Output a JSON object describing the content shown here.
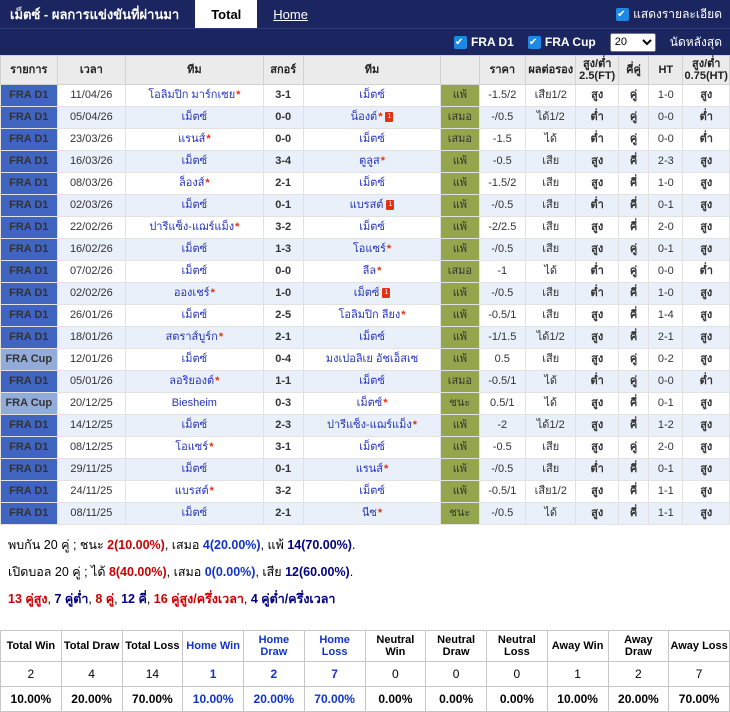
{
  "titlebar": {
    "title": "เม็ตซ์ - ผลการแข่งขันที่ผ่านมา",
    "tabs": [
      {
        "label": "Total",
        "active": true
      },
      {
        "label": "Home",
        "active": false
      }
    ],
    "show_details_label": "แสดงรายละเอียด"
  },
  "filters": {
    "league_checkboxes": [
      "FRA D1",
      "FRA Cup"
    ],
    "match_count": "20",
    "match_count_label": "นัดหลังสุด"
  },
  "table": {
    "headers": [
      "รายการ",
      "เวลา",
      "ทีม",
      "สกอร์",
      "ทีม",
      "",
      "ราคา",
      "ผลต่อรอง",
      "สูง/ต่ำ 2.5(FT)",
      "คี่คู่",
      "HT",
      "สูง/ต่ำ 0.75(HT)"
    ]
  },
  "matches": [
    {
      "league": "FRA D1",
      "date": "11/04/26",
      "team1": {
        "name": "โอลิมปิก มาร์กเซย",
        "star": true,
        "card": false
      },
      "score": "3-1",
      "team2": {
        "name": "เม็ตซ์",
        "star": false,
        "card": false
      },
      "result": "แพ้",
      "price": "-1.5/2",
      "odds": "เสีย1/2",
      "ou25": "สูง",
      "oe": "คู่",
      "ht": "1-0",
      "ou075": "สูง"
    },
    {
      "league": "FRA D1",
      "date": "05/04/26",
      "team1": {
        "name": "เม็ตซ์",
        "star": false,
        "card": false
      },
      "score": "0-0",
      "team2": {
        "name": "น็องต์",
        "star": true,
        "card": true
      },
      "result": "เสมอ",
      "price": "-/0.5",
      "odds": "ได้1/2",
      "ou25": "ต่ำ",
      "oe": "คู่",
      "ht": "0-0",
      "ou075": "ต่ำ"
    },
    {
      "league": "FRA D1",
      "date": "23/03/26",
      "team1": {
        "name": "แรนส์",
        "star": true,
        "card": false
      },
      "score": "0-0",
      "team2": {
        "name": "เม็ตซ์",
        "star": false,
        "card": false
      },
      "result": "เสมอ",
      "price": "-1.5",
      "odds": "ได้",
      "ou25": "ต่ำ",
      "oe": "คู่",
      "ht": "0-0",
      "ou075": "ต่ำ"
    },
    {
      "league": "FRA D1",
      "date": "16/03/26",
      "team1": {
        "name": "เม็ตซ์",
        "star": false,
        "card": false
      },
      "score": "3-4",
      "team2": {
        "name": "ตูลูส",
        "star": true,
        "card": false
      },
      "result": "แพ้",
      "price": "-0.5",
      "odds": "เสีย",
      "ou25": "สูง",
      "oe": "คี่",
      "ht": "2-3",
      "ou075": "สูง"
    },
    {
      "league": "FRA D1",
      "date": "08/03/26",
      "team1": {
        "name": "ล็องส์",
        "star": true,
        "card": false
      },
      "score": "2-1",
      "team2": {
        "name": "เม็ตซ์",
        "star": false,
        "card": false
      },
      "result": "แพ้",
      "price": "-1.5/2",
      "odds": "เสีย",
      "ou25": "สูง",
      "oe": "คี่",
      "ht": "1-0",
      "ou075": "สูง"
    },
    {
      "league": "FRA D1",
      "date": "02/03/26",
      "team1": {
        "name": "เม็ตซ์",
        "star": false,
        "card": false
      },
      "score": "0-1",
      "team2": {
        "name": "แบรสต์",
        "star": false,
        "card": true
      },
      "result": "แพ้",
      "price": "-/0.5",
      "odds": "เสีย",
      "ou25": "ต่ำ",
      "oe": "คี่",
      "ht": "0-1",
      "ou075": "สูง"
    },
    {
      "league": "FRA D1",
      "date": "22/02/26",
      "team1": {
        "name": "ปารีแซ็ง-แฌร์แม็ง",
        "star": true,
        "card": false
      },
      "score": "3-2",
      "team2": {
        "name": "เม็ตซ์",
        "star": false,
        "card": false
      },
      "result": "แพ้",
      "price": "-2/2.5",
      "odds": "เสีย",
      "ou25": "สูง",
      "oe": "คี่",
      "ht": "2-0",
      "ou075": "สูง"
    },
    {
      "league": "FRA D1",
      "date": "16/02/26",
      "team1": {
        "name": "เม็ตซ์",
        "star": false,
        "card": false
      },
      "score": "1-3",
      "team2": {
        "name": "โอแซร์",
        "star": true,
        "card": false
      },
      "result": "แพ้",
      "price": "-/0.5",
      "odds": "เสีย",
      "ou25": "สูง",
      "oe": "คู่",
      "ht": "0-1",
      "ou075": "สูง"
    },
    {
      "league": "FRA D1",
      "date": "07/02/26",
      "team1": {
        "name": "เม็ตซ์",
        "star": false,
        "card": false
      },
      "score": "0-0",
      "team2": {
        "name": "ลีล",
        "star": true,
        "card": false
      },
      "result": "เสมอ",
      "price": "-1",
      "odds": "ได้",
      "ou25": "ต่ำ",
      "oe": "คู่",
      "ht": "0-0",
      "ou075": "ต่ำ"
    },
    {
      "league": "FRA D1",
      "date": "02/02/26",
      "team1": {
        "name": "อองเชร์",
        "star": true,
        "card": false
      },
      "score": "1-0",
      "team2": {
        "name": "เม็ตซ์",
        "star": false,
        "card": true
      },
      "result": "แพ้",
      "price": "-/0.5",
      "odds": "เสีย",
      "ou25": "ต่ำ",
      "oe": "คี่",
      "ht": "1-0",
      "ou075": "สูง"
    },
    {
      "league": "FRA D1",
      "date": "26/01/26",
      "team1": {
        "name": "เม็ตซ์",
        "star": false,
        "card": false
      },
      "score": "2-5",
      "team2": {
        "name": "โอลิมปิก ลียง",
        "star": true,
        "card": false
      },
      "result": "แพ้",
      "price": "-0.5/1",
      "odds": "เสีย",
      "ou25": "สูง",
      "oe": "คี่",
      "ht": "1-4",
      "ou075": "สูง"
    },
    {
      "league": "FRA D1",
      "date": "18/01/26",
      "team1": {
        "name": "สตราส์บูร์ก",
        "star": true,
        "card": false
      },
      "score": "2-1",
      "team2": {
        "name": "เม็ตซ์",
        "star": false,
        "card": false
      },
      "result": "แพ้",
      "price": "-1/1.5",
      "odds": "ได้1/2",
      "ou25": "สูง",
      "oe": "คี่",
      "ht": "2-1",
      "ou075": "สูง"
    },
    {
      "league": "FRA Cup",
      "date": "12/01/26",
      "team1": {
        "name": "เม็ตซ์",
        "star": false,
        "card": false
      },
      "score": "0-4",
      "team2": {
        "name": "มงเปอลิเย อัชเอ็สเซ",
        "star": false,
        "card": false
      },
      "result": "แพ้",
      "price": "0.5",
      "odds": "เสีย",
      "ou25": "สูง",
      "oe": "คู่",
      "ht": "0-2",
      "ou075": "สูง"
    },
    {
      "league": "FRA D1",
      "date": "05/01/26",
      "team1": {
        "name": "ลอริยองต์",
        "star": true,
        "card": false
      },
      "score": "1-1",
      "team2": {
        "name": "เม็ตซ์",
        "star": false,
        "card": false
      },
      "result": "เสมอ",
      "price": "-0.5/1",
      "odds": "ได้",
      "ou25": "ต่ำ",
      "oe": "คู่",
      "ht": "0-0",
      "ou075": "ต่ำ"
    },
    {
      "league": "FRA Cup",
      "date": "20/12/25",
      "team1": {
        "name": "Biesheim",
        "star": false,
        "card": false
      },
      "score": "0-3",
      "team2": {
        "name": "เม็ตซ์",
        "star": true,
        "card": false
      },
      "result": "ชนะ",
      "price": "0.5/1",
      "odds": "ได้",
      "ou25": "สูง",
      "oe": "คี่",
      "ht": "0-1",
      "ou075": "สูง"
    },
    {
      "league": "FRA D1",
      "date": "14/12/25",
      "team1": {
        "name": "เม็ตซ์",
        "star": false,
        "card": false
      },
      "score": "2-3",
      "team2": {
        "name": "ปารีแซ็ง-แฌร์แม็ง",
        "star": true,
        "card": false
      },
      "result": "แพ้",
      "price": "-2",
      "odds": "ได้1/2",
      "ou25": "สูง",
      "oe": "คี่",
      "ht": "1-2",
      "ou075": "สูง"
    },
    {
      "league": "FRA D1",
      "date": "08/12/25",
      "team1": {
        "name": "โอแซร์",
        "star": true,
        "card": false
      },
      "score": "3-1",
      "team2": {
        "name": "เม็ตซ์",
        "star": false,
        "card": false
      },
      "result": "แพ้",
      "price": "-0.5",
      "odds": "เสีย",
      "ou25": "สูง",
      "oe": "คู่",
      "ht": "2-0",
      "ou075": "สูง"
    },
    {
      "league": "FRA D1",
      "date": "29/11/25",
      "team1": {
        "name": "เม็ตซ์",
        "star": false,
        "card": false
      },
      "score": "0-1",
      "team2": {
        "name": "แรนส์",
        "star": true,
        "card": false
      },
      "result": "แพ้",
      "price": "-/0.5",
      "odds": "เสีย",
      "ou25": "ต่ำ",
      "oe": "คี่",
      "ht": "0-1",
      "ou075": "สูง"
    },
    {
      "league": "FRA D1",
      "date": "24/11/25",
      "team1": {
        "name": "แบรสต์",
        "star": true,
        "card": false
      },
      "score": "3-2",
      "team2": {
        "name": "เม็ตซ์",
        "star": false,
        "card": false
      },
      "result": "แพ้",
      "price": "-0.5/1",
      "odds": "เสีย1/2",
      "ou25": "สูง",
      "oe": "คี่",
      "ht": "1-1",
      "ou075": "สูง"
    },
    {
      "league": "FRA D1",
      "date": "08/11/25",
      "team1": {
        "name": "เม็ตซ์",
        "star": false,
        "card": false
      },
      "score": "2-1",
      "team2": {
        "name": "นีซ",
        "star": true,
        "card": false
      },
      "result": "ชนะ",
      "price": "-/0.5",
      "odds": "ได้",
      "ou25": "สูง",
      "oe": "คี่",
      "ht": "1-1",
      "ou075": "สูง"
    }
  ],
  "summary_lines": [
    {
      "segments": [
        {
          "text": "พบกัน 20 คู่ ; ชนะ ",
          "color": "text"
        },
        {
          "text": "2(10.00%)",
          "color": "red"
        },
        {
          "text": ", เสมอ ",
          "color": "text"
        },
        {
          "text": "4(20.00%)",
          "color": "blue"
        },
        {
          "text": ", แพ้ ",
          "color": "text"
        },
        {
          "text": "14(70.00%)",
          "color": "navy"
        },
        {
          "text": ".",
          "color": "text"
        }
      ]
    },
    {
      "segments": [
        {
          "text": "เปิดบอล 20 คู่ ; ได้ ",
          "color": "text"
        },
        {
          "text": "8(40.00%)",
          "color": "red"
        },
        {
          "text": ", เสมอ ",
          "color": "text"
        },
        {
          "text": "0(0.00%)",
          "color": "blue"
        },
        {
          "text": ", เสีย ",
          "color": "text"
        },
        {
          "text": "12(60.00%)",
          "color": "navy"
        },
        {
          "text": ".",
          "color": "text"
        }
      ]
    },
    {
      "segments": [
        {
          "text": "13 คู่สูง",
          "color": "red"
        },
        {
          "text": ", ",
          "color": "text"
        },
        {
          "text": "7 คู่ต่ำ",
          "color": "navy"
        },
        {
          "text": ", ",
          "color": "text"
        },
        {
          "text": "8 คู่",
          "color": "red"
        },
        {
          "text": ", ",
          "color": "text"
        },
        {
          "text": "12 คี่",
          "color": "navy"
        },
        {
          "text": ", ",
          "color": "text"
        },
        {
          "text": "16 คู่สูง/ครึ่งเวลา",
          "color": "red"
        },
        {
          "text": ", ",
          "color": "text"
        },
        {
          "text": "4 คู่ต่ำ/ครึ่งเวลา",
          "color": "navy"
        }
      ]
    }
  ],
  "stats_table": {
    "headers": [
      "Total Win",
      "Total Draw",
      "Total Loss",
      "Home Win",
      "Home Draw",
      "Home Loss",
      "Neutral Win",
      "Neutral Draw",
      "Neutral Loss",
      "Away Win",
      "Away Draw",
      "Away Loss"
    ],
    "counts": [
      "2",
      "4",
      "14",
      "1",
      "2",
      "7",
      "0",
      "0",
      "0",
      "1",
      "2",
      "7"
    ],
    "percents": [
      "10.00%",
      "20.00%",
      "70.00%",
      "10.00%",
      "20.00%",
      "70.00%",
      "0.00%",
      "0.00%",
      "0.00%",
      "10.00%",
      "20.00%",
      "70.00%"
    ],
    "highlight_columns": [
      3,
      4,
      5
    ]
  },
  "colors": {
    "navy_bar": "#1b2660",
    "accent_blue_checkbox": "#1e88e5",
    "league_d1": "#3f65c0",
    "league_cup": "#92abd8",
    "row_alt": "#e9f0f9",
    "link": "#2533c0",
    "score": "#1b2a6b",
    "result_green": "#93a64d",
    "win_red": "#cc2200",
    "lose_blue": "#2d4fae",
    "over": "#d2500a",
    "under": "#8b5413",
    "odd_even": "#d2691e",
    "ht_green": "#0a8043",
    "star_red": "#e53012",
    "summary_red": "#cc0000",
    "summary_blue": "#1133cc",
    "summary_navy": "#000080",
    "stats_highlight": "#1133cc"
  }
}
